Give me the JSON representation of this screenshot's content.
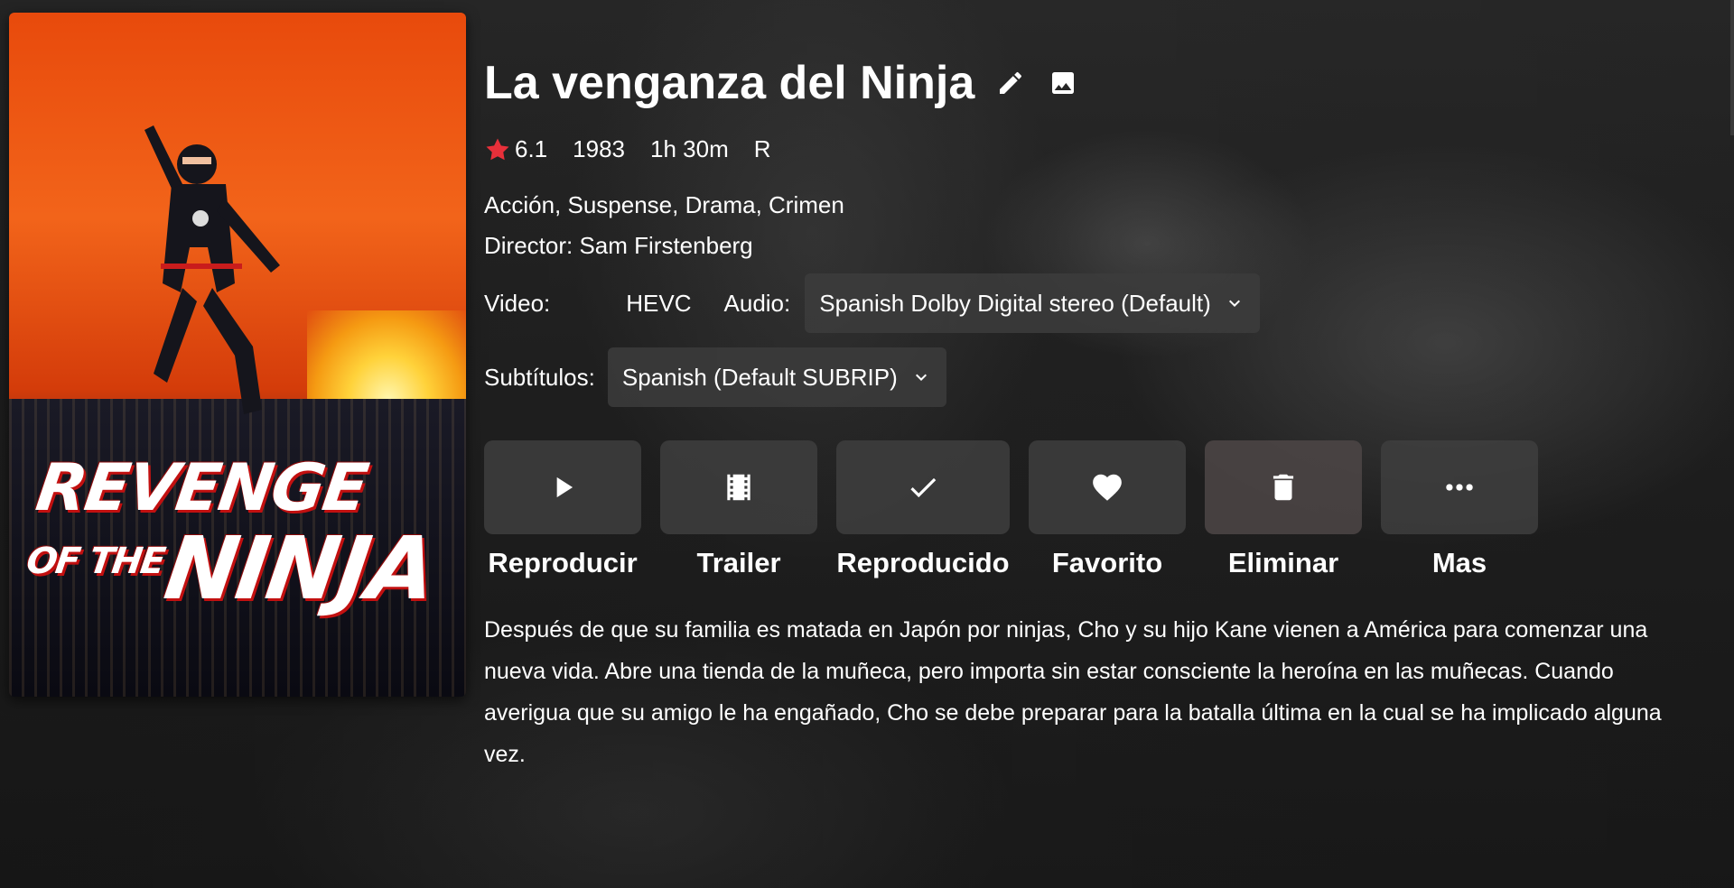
{
  "movie": {
    "title": "La venganza del Ninja",
    "rating": "6.1",
    "year": "1983",
    "runtime": "1h 30m",
    "certification": "R",
    "genres": "Acción, Suspense, Drama, Crimen",
    "director": "Director: Sam Firstenberg",
    "overview": "Después de que su familia es matada en Japón por ninjas, Cho y su hijo Kane vienen a América para comenzar una nueva vida. Abre una tienda de la muñeca, pero importa sin estar consciente la heroína en las muñecas. Cuando averigua que su amigo le ha engañado, Cho se debe preparar para la batalla última en la cual se ha implicado alguna vez."
  },
  "poster": {
    "line1": "REVENGE",
    "line2_small": "OF THE",
    "line2": "NINJA"
  },
  "media": {
    "video_label": "Video:",
    "video_value": "HEVC",
    "audio_label": "Audio:",
    "audio_selected": "Spanish Dolby Digital stereo (Default)",
    "subtitles_label": "Subtítulos:",
    "subtitles_selected": "Spanish (Default SUBRIP)"
  },
  "actions": {
    "play": "Reproducir",
    "trailer": "Trailer",
    "played": "Reproducido",
    "favorite": "Favorito",
    "delete": "Eliminar",
    "more": "Mas"
  },
  "icons": {
    "edit": "pencil-icon",
    "image": "image-icon",
    "star": "star-icon",
    "play": "play-icon",
    "trailer": "film-icon",
    "played": "check-icon",
    "favorite": "heart-icon",
    "delete": "trash-icon",
    "more": "more-dots-icon"
  },
  "colors": {
    "star": "#e8303a",
    "button_bg": "#3e3e3e",
    "text": "#ffffff"
  }
}
